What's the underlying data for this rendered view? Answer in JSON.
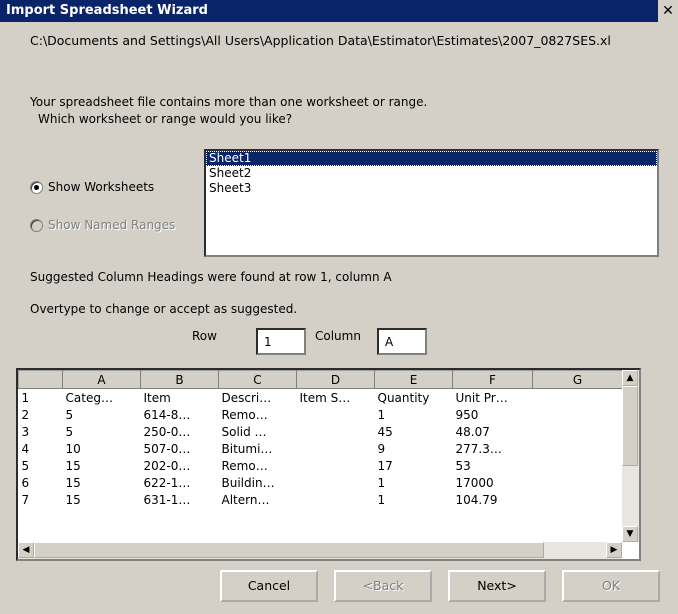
{
  "window": {
    "title": "Import Spreadsheet Wizard",
    "close_glyph": "✕"
  },
  "file_path": "C:\\Documents and Settings\\All Users\\Application Data\\Estimator\\Estimates\\2007_0827SES.xl",
  "question_line1": "Your spreadsheet file contains more than one worksheet or range.",
  "question_line2": "Which worksheet or range would you like?",
  "options": {
    "show_worksheets": {
      "label": "Show Worksheets",
      "checked": true
    },
    "show_named_ranges": {
      "label": "Show Named Ranges",
      "enabled": false
    }
  },
  "worksheets": [
    {
      "name": "Sheet1",
      "selected": true
    },
    {
      "name": "Sheet2",
      "selected": false
    },
    {
      "name": "Sheet3",
      "selected": false
    }
  ],
  "suggestion_text": "Suggested Column Headings were found at row 1, column A",
  "overtype_text": "Overtype to change or accept as suggested.",
  "row_label": "Row",
  "row_value": "1",
  "column_label": "Column",
  "column_value": "A",
  "grid": {
    "headers": [
      "",
      "A",
      "B",
      "C",
      "D",
      "E",
      "F",
      "G"
    ],
    "rows": [
      [
        "1",
        "Categ…",
        "Item",
        "Descri…",
        "Item S…",
        "Quantity",
        "Unit Pr…",
        ""
      ],
      [
        "2",
        "5",
        "614-8…",
        "Remo…",
        "",
        "1",
        "950",
        ""
      ],
      [
        "3",
        "5",
        "250-0…",
        "Solid …",
        "",
        "45",
        "48.07",
        ""
      ],
      [
        "4",
        "10",
        "507-0…",
        "Bitumi…",
        "",
        "9",
        "277.3…",
        ""
      ],
      [
        "5",
        "15",
        "202-0…",
        "Remo…",
        "",
        "17",
        "53",
        ""
      ],
      [
        "6",
        "15",
        "622-1…",
        "Buildin…",
        "",
        "1",
        "17000",
        ""
      ],
      [
        "7",
        "15",
        "631-1…",
        "Altern…",
        "",
        "1",
        "104.79",
        ""
      ]
    ]
  },
  "buttons": {
    "cancel": "Cancel",
    "back": "<Back",
    "next": "Next>",
    "ok": "OK"
  },
  "icons": {
    "scroll_up": "▲",
    "scroll_down": "▼",
    "scroll_left": "◀",
    "scroll_right": "▶"
  }
}
